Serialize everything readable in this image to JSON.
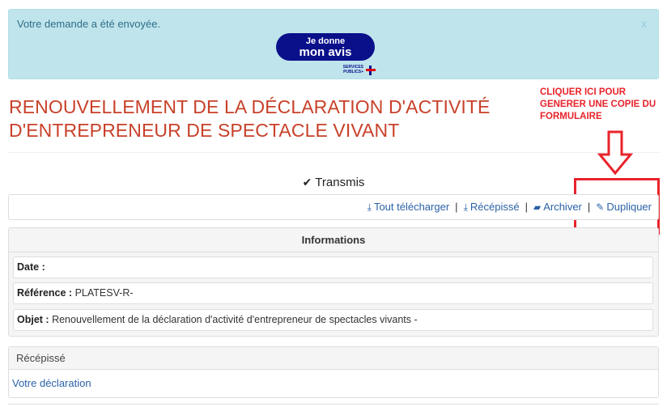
{
  "alert": {
    "message": "Votre demande a été envoyée.",
    "close_label": "x",
    "badge_line1": "Je donne",
    "badge_line2": "mon avis",
    "logo_text": "SERVICES PUBLICS+"
  },
  "title": "RENOUVELLEMENT DE LA DÉCLARATION D'ACTIVITÉ D'ENTREPRENEUR DE SPECTACLE VIVANT",
  "annotation": {
    "text": "CLIQUER ICI POUR GENERER UNE COPIE DU FORMULAIRE",
    "color": "#e8232b"
  },
  "status": {
    "icon": "check-icon",
    "label": "Transmis"
  },
  "actions": [
    {
      "label": "Tout télécharger",
      "icon": "download-icon"
    },
    {
      "label": "Récépissé",
      "icon": "download-icon"
    },
    {
      "label": "Archiver",
      "icon": "folder-icon"
    },
    {
      "label": "Dupliquer",
      "icon": "pencil-icon"
    }
  ],
  "actions_separator": "|",
  "informations": {
    "heading": "Informations",
    "date_label": "Date :",
    "date_value": "",
    "reference_label": "Référence :",
    "reference_value": "PLATESV-R-",
    "objet_label": "Objet :",
    "objet_value": "Renouvellement de la déclaration d'activité d'entrepreneur de spectacles vivants -"
  },
  "recepisse": {
    "heading": "Récépissé",
    "link": "Votre déclaration"
  },
  "colors": {
    "title": "#c8412a",
    "alert_bg": "#bfe4ec",
    "link": "#2b62a8",
    "badge": "#0a0f8a"
  }
}
